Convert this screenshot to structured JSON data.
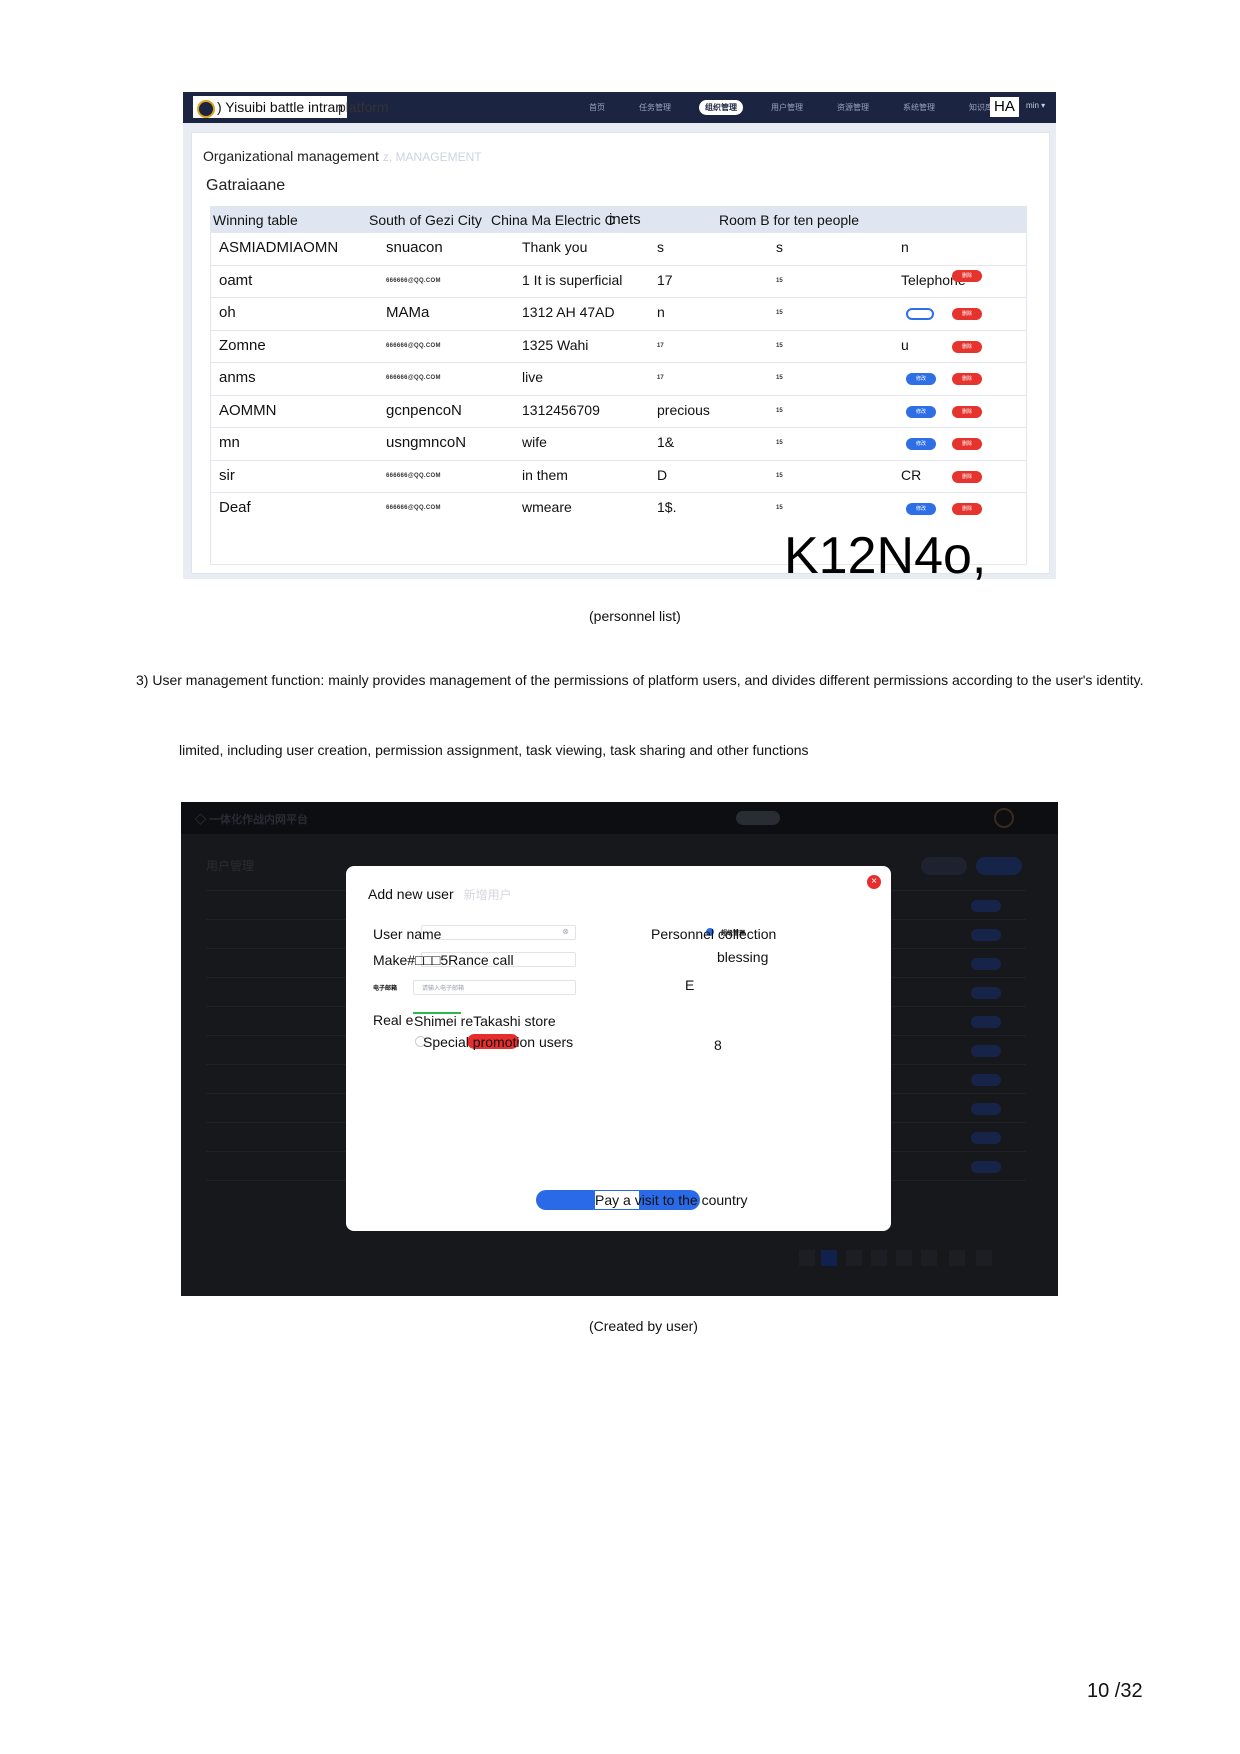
{
  "figure1": {
    "brand": ") Yisuibi battle intran",
    "brand_suffix": "platform",
    "nav_items": [
      "首页",
      "任务管理",
      "组织管理",
      "用户管理",
      "资源管理",
      "系统管理",
      "知识库管理"
    ],
    "nav_active_index": 2,
    "user_badge": "HA",
    "user_caret": "min ▾",
    "breadcrumb": "Organizational management",
    "breadcrumb_faint": "z, MANAGEMENT",
    "section_title": "Gatraiaane",
    "columns": [
      "Winning table",
      "South of Gezi City",
      "China Ma Electric C",
      "inets",
      "Room B for ten people"
    ],
    "rows": [
      {
        "name": "ASMIADMIAOMN",
        "email": "snuacon",
        "phone": "Thank you",
        "dept": "s",
        "room": "s",
        "op": "n"
      },
      {
        "name": "oamt",
        "email": "666666@QQ.COM",
        "phone": "1 It is superficial",
        "dept": "17",
        "room": "15",
        "op": "Telephone"
      },
      {
        "name": "oh",
        "email": "MAMa",
        "phone": "1312 AH 47AD",
        "dept": "n",
        "room": "15",
        "op": ""
      },
      {
        "name": "Zomne",
        "email": "666666@QQ.COM",
        "phone": "1325 Wahi",
        "dept": "17",
        "room": "15",
        "op": "u"
      },
      {
        "name": "anms",
        "email": "666666@QQ.COM",
        "phone": "live",
        "dept": "17",
        "room": "15",
        "op": ""
      },
      {
        "name": "AOMMN",
        "email": "gcnpencoN",
        "phone": "1312456709",
        "dept": "precious",
        "room": "15",
        "op": ""
      },
      {
        "name": "mn",
        "email": "usngmncoN",
        "phone": "wife",
        "dept": "1&",
        "room": "15",
        "op": ""
      },
      {
        "name": "sir",
        "email": "666666@QQ.COM",
        "phone": "in them",
        "dept": "D",
        "room": "15",
        "op": "CR"
      },
      {
        "name": "Deaf",
        "email": "666666@QQ.COM",
        "phone": "wmeare",
        "dept": "1$.",
        "room": "15",
        "op": ""
      }
    ],
    "edit_label": "修改",
    "delete_label": "删除",
    "watermark": "K12N4o,"
  },
  "caption1": "(personnel list)",
  "paragraph_line1": "3) User management function: mainly provides management of the permissions of platform users, and divides different permissions according to the user's identity.",
  "paragraph_line2": "limited, including user creation, permission assignment, task viewing, task sharing and other functions",
  "figure2": {
    "modal_title": "Add new user",
    "modal_title_faint": "新增用户",
    "close_icon": "×",
    "field_username": "User name",
    "field_make": "Make#□□□5R",
    "field_make_suffix": "ance call",
    "email_label": "电子邮箱",
    "email_placeholder": "请输入电子邮箱",
    "field_real": "Real e",
    "field_real_value": "Shimei reTakashi store",
    "field_special": "Special promotion users",
    "right_personnel": "Personnel collection",
    "right_personnel_tag": "超级管理",
    "right_blessing": "blessing",
    "right_e": "E",
    "right_8": "8",
    "submit_label": "Pay a visit to the country"
  },
  "caption2": "(Created by user)",
  "page_number": "10 /32"
}
